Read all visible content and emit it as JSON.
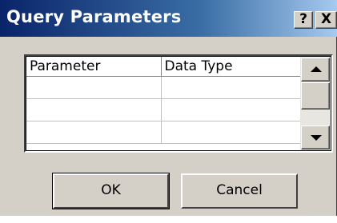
{
  "dialog": {
    "title": "Query Parameters",
    "title_buttons": {
      "help": "?",
      "close": "X"
    }
  },
  "grid": {
    "columns": [
      "Parameter",
      "Data Type"
    ],
    "rows": [
      [
        "",
        ""
      ],
      [
        "",
        ""
      ],
      [
        "",
        ""
      ]
    ]
  },
  "buttons": {
    "ok": "OK",
    "cancel": "Cancel"
  },
  "colors": {
    "title_start": "#0a246a",
    "title_end": "#a6caf0",
    "face": "#d4d0c8"
  }
}
